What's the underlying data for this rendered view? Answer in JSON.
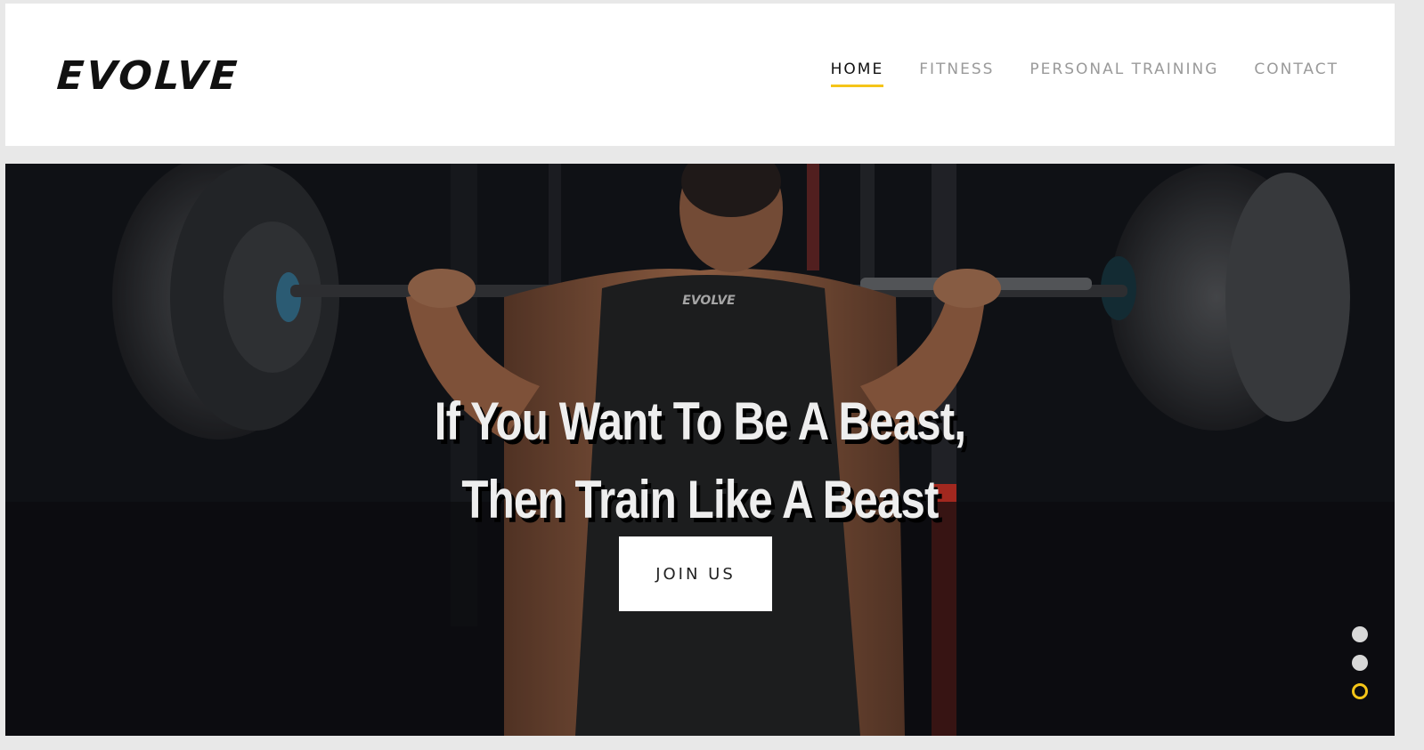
{
  "header": {
    "logo_text": "EVOLVE",
    "nav": [
      {
        "label": "HOME",
        "active": true
      },
      {
        "label": "FITNESS",
        "active": false
      },
      {
        "label": "PERSONAL TRAINING",
        "active": false
      },
      {
        "label": "CONTACT",
        "active": false
      }
    ]
  },
  "hero": {
    "headline_line1": "If You Want To Be A Beast,",
    "headline_line2": "Then Train Like A Beast",
    "cta_label": "JOIN US",
    "shirt_logo": "EVOLVE",
    "slides": {
      "count": 3,
      "active_index": 2
    }
  },
  "colors": {
    "accent": "#f5c518",
    "header_bg": "#ffffff",
    "hero_bg": "#16181d",
    "text_dark": "#111111",
    "nav_inactive": "#9a9a9a"
  }
}
